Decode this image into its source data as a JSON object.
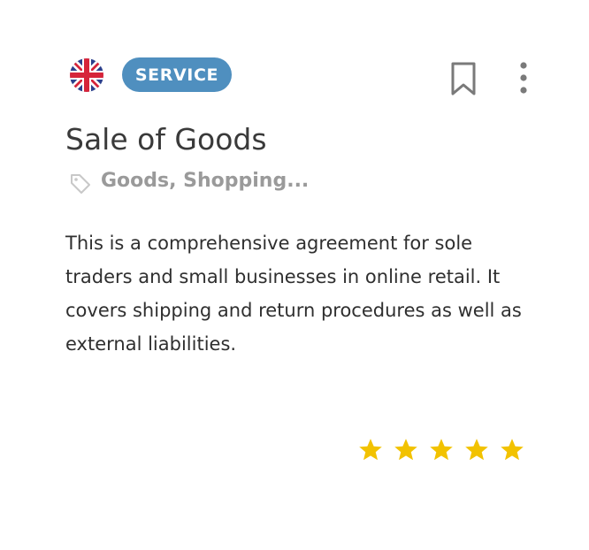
{
  "card": {
    "badge": "SERVICE",
    "title": "Sale of Goods",
    "tags": "Goods, Shopping...",
    "description": "This is a comprehensive agreement for sole traders and small businesses in online retail. It covers shipping and return procedures as well as external liabilities.",
    "rating": 5,
    "rating_max": 5,
    "colors": {
      "badge": "#4f8fbf",
      "star": "#f2c200",
      "title": "#3a3a3a",
      "tags": "#9a9a9a"
    },
    "icons": {
      "flag": "uk-flag-icon",
      "bookmark": "bookmark-icon",
      "menu": "more-vertical-icon",
      "tag": "tag-icon",
      "star": "star-icon"
    }
  }
}
